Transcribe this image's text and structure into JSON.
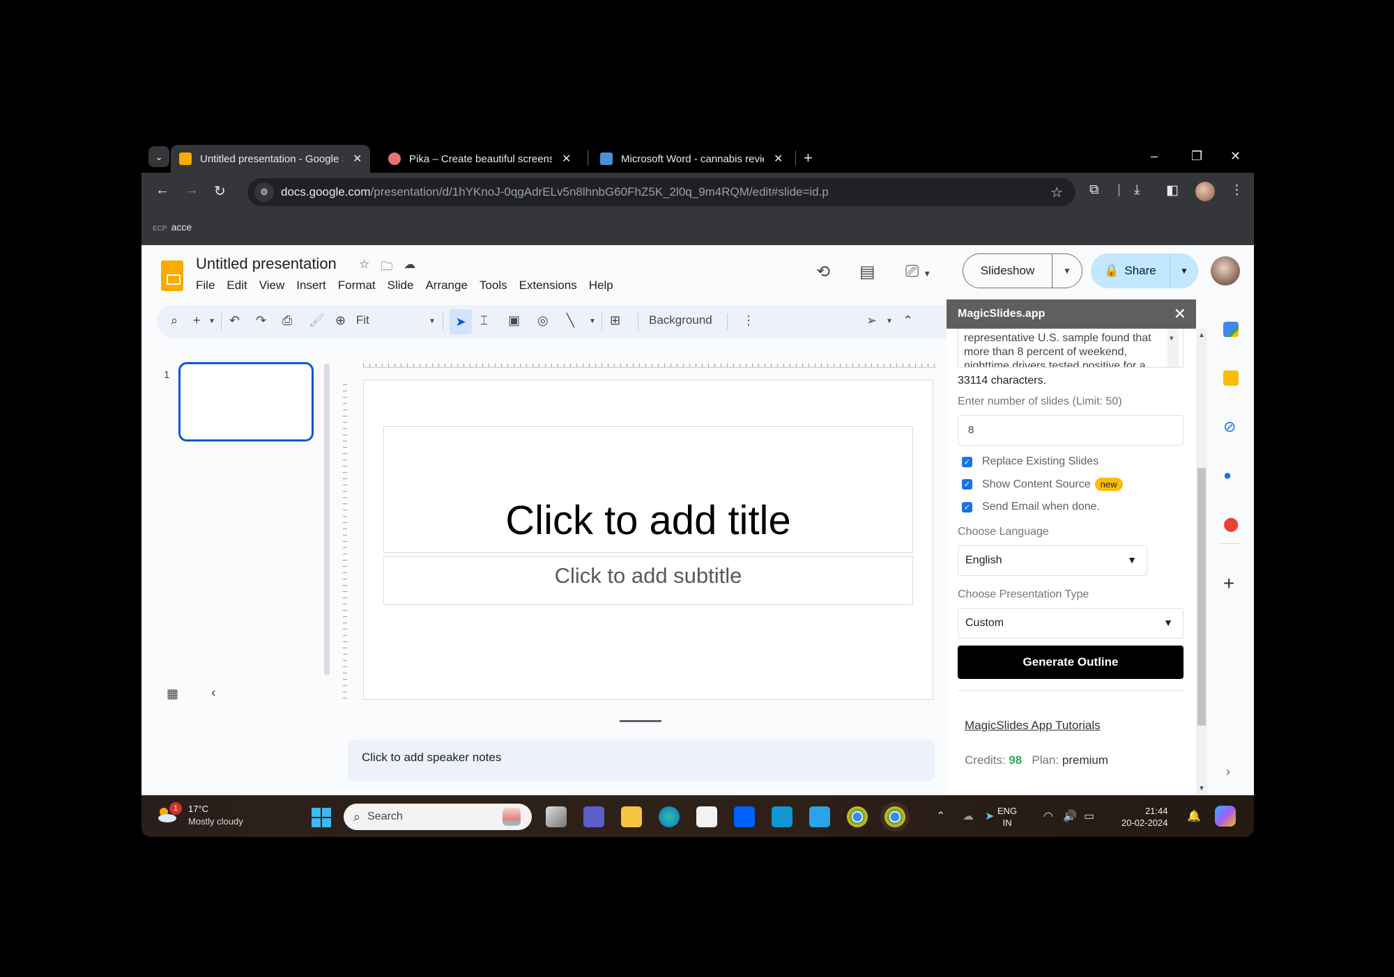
{
  "browser": {
    "tabs": [
      {
        "title": "Untitled presentation - Google Slides",
        "favicon": "google-slides-icon",
        "color": "#f9ab00",
        "active": true
      },
      {
        "title": "Pika – Create beautiful screenshots",
        "favicon": "pika-icon",
        "color": "#e57373",
        "active": false
      },
      {
        "title": "Microsoft Word - cannabis review",
        "favicon": "word-doc-icon",
        "color": "#4a90d9",
        "active": false
      }
    ],
    "new_tab": "+",
    "window_controls": {
      "minimize": "–",
      "restore": "❐",
      "close": "✕"
    },
    "url_domain": "docs.google.com",
    "url_path": "/presentation/d/1hYKnoJ-0qgAdrELv5n8lhnbG60FhZ5K_2l0q_9m4RQM/edit#slide=id.p",
    "bookmark": {
      "icon": "ECP",
      "label": "acce"
    }
  },
  "docs": {
    "title": "Untitled presentation",
    "menu": [
      "File",
      "Edit",
      "View",
      "Insert",
      "Format",
      "Slide",
      "Arrange",
      "Tools",
      "Extensions",
      "Help"
    ],
    "slideshow_label": "Slideshow",
    "share_label": "Share",
    "toolbar": {
      "zoom": "Fit",
      "background": "Background"
    },
    "filmstrip": {
      "slide_number": "1"
    },
    "slide": {
      "title_placeholder": "Click to add title",
      "subtitle_placeholder": "Click to add subtitle"
    },
    "notes_placeholder": "Click to add speaker notes"
  },
  "magicslides": {
    "header": "MagicSlides.app",
    "text_excerpt": "representative U.S. sample found that more than 8 percent of weekend, nighttime drivers tested positive for a",
    "char_count": "33114 characters.",
    "slides_label": "Enter number of slides (Limit: 50)",
    "slides_value": "8",
    "checkboxes": [
      {
        "label": "Replace Existing Slides",
        "checked": true,
        "badge": ""
      },
      {
        "label": "Show Content Source",
        "checked": true,
        "badge": "new"
      },
      {
        "label": "Send Email when done.",
        "checked": true,
        "badge": ""
      }
    ],
    "language_label": "Choose Language",
    "language_value": "English",
    "type_label": "Choose Presentation Type",
    "type_value": "Custom",
    "generate_label": "Generate Outline",
    "tutorials_link": "MagicSlides App Tutorials",
    "credits_label": "Credits:",
    "credits_value": "98",
    "plan_label": "Plan:",
    "plan_value": "premium"
  },
  "taskbar": {
    "weather_badge": "1",
    "temperature": "17°C",
    "condition": "Mostly cloudy",
    "search_placeholder": "Search",
    "language_line1": "ENG",
    "language_line2": "IN",
    "time": "21:44",
    "date": "20-02-2024"
  }
}
